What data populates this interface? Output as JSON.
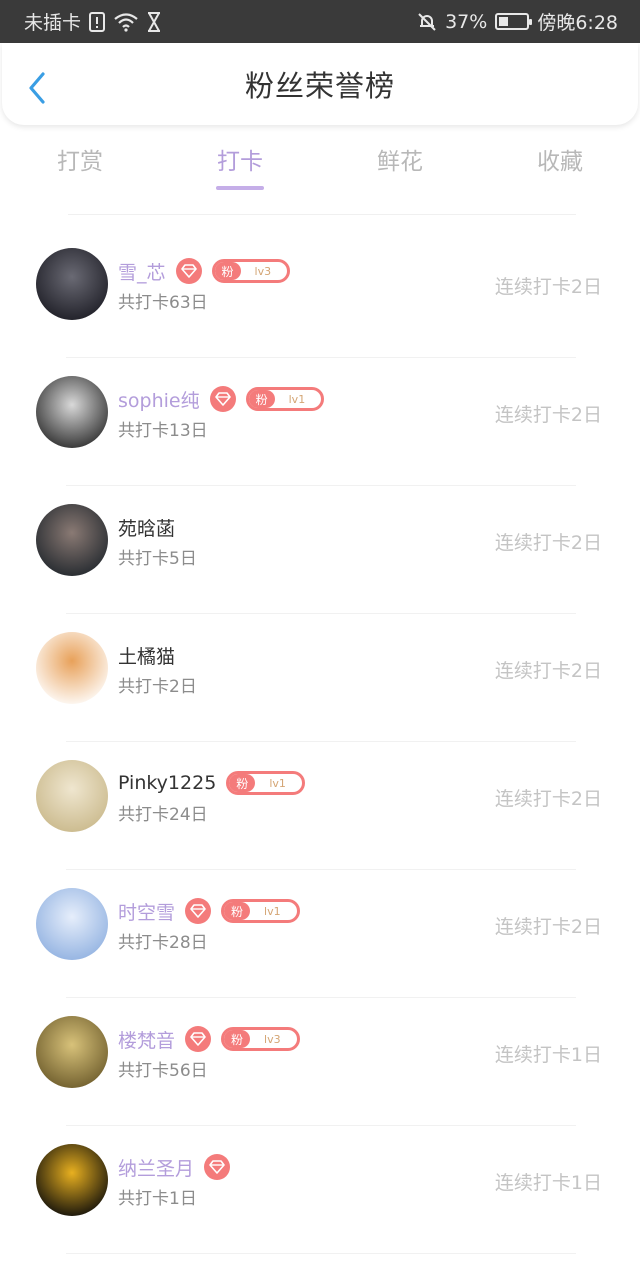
{
  "status_bar": {
    "carrier": "未插卡",
    "battery": "37%",
    "time": "傍晚6:28"
  },
  "header": {
    "title": "粉丝荣誉榜"
  },
  "tabs": [
    {
      "label": "打赏",
      "active": false
    },
    {
      "label": "打卡",
      "active": true
    },
    {
      "label": "鲜花",
      "active": false
    },
    {
      "label": "收藏",
      "active": false
    }
  ],
  "colors": {
    "accent": "#b39ddb",
    "badge": "#f47b7b"
  },
  "list": [
    {
      "name": "雪_芯",
      "colored": true,
      "diamond": true,
      "fan_tag": "粉",
      "fan_level": "lv3",
      "total": "共打卡63日",
      "streak": "连续打卡2日",
      "avatar": [
        "#1c1c24",
        "#6a6a74"
      ]
    },
    {
      "name": "sophie纯",
      "colored": true,
      "diamond": true,
      "fan_tag": "粉",
      "fan_level": "lv1",
      "total": "共打卡13日",
      "streak": "连续打卡2日",
      "avatar": [
        "#2a2a2a",
        "#d9d9d9"
      ]
    },
    {
      "name": "苑晗菡",
      "colored": false,
      "diamond": false,
      "fan_tag": "",
      "fan_level": "",
      "total": "共打卡5日",
      "streak": "连续打卡2日",
      "avatar": [
        "#20262c",
        "#8a7a74"
      ]
    },
    {
      "name": "土橘猫",
      "colored": false,
      "diamond": false,
      "fan_tag": "",
      "fan_level": "",
      "total": "共打卡2日",
      "streak": "连续打卡2日",
      "avatar": [
        "#ffffff",
        "#e8a15a"
      ]
    },
    {
      "name": "Pinky1225",
      "colored": false,
      "diamond": false,
      "fan_tag": "粉",
      "fan_level": "lv1",
      "total": "共打卡24日",
      "streak": "连续打卡2日",
      "avatar": [
        "#c9b88a",
        "#efe6cf"
      ]
    },
    {
      "name": "时空雪",
      "colored": true,
      "diamond": true,
      "fan_tag": "粉",
      "fan_level": "lv1",
      "total": "共打卡28日",
      "streak": "连续打卡2日",
      "avatar": [
        "#8fb0e0",
        "#e6eefb"
      ]
    },
    {
      "name": "楼梵音",
      "colored": true,
      "diamond": true,
      "fan_tag": "粉",
      "fan_level": "lv3",
      "total": "共打卡56日",
      "streak": "连续打卡1日",
      "avatar": [
        "#6b5a2a",
        "#d8c27a"
      ]
    },
    {
      "name": "纳兰圣月",
      "colored": true,
      "diamond": true,
      "fan_tag": "",
      "fan_level": "",
      "total": "共打卡1日",
      "streak": "连续打卡1日",
      "avatar": [
        "#0a0a0a",
        "#e8b020"
      ]
    }
  ]
}
